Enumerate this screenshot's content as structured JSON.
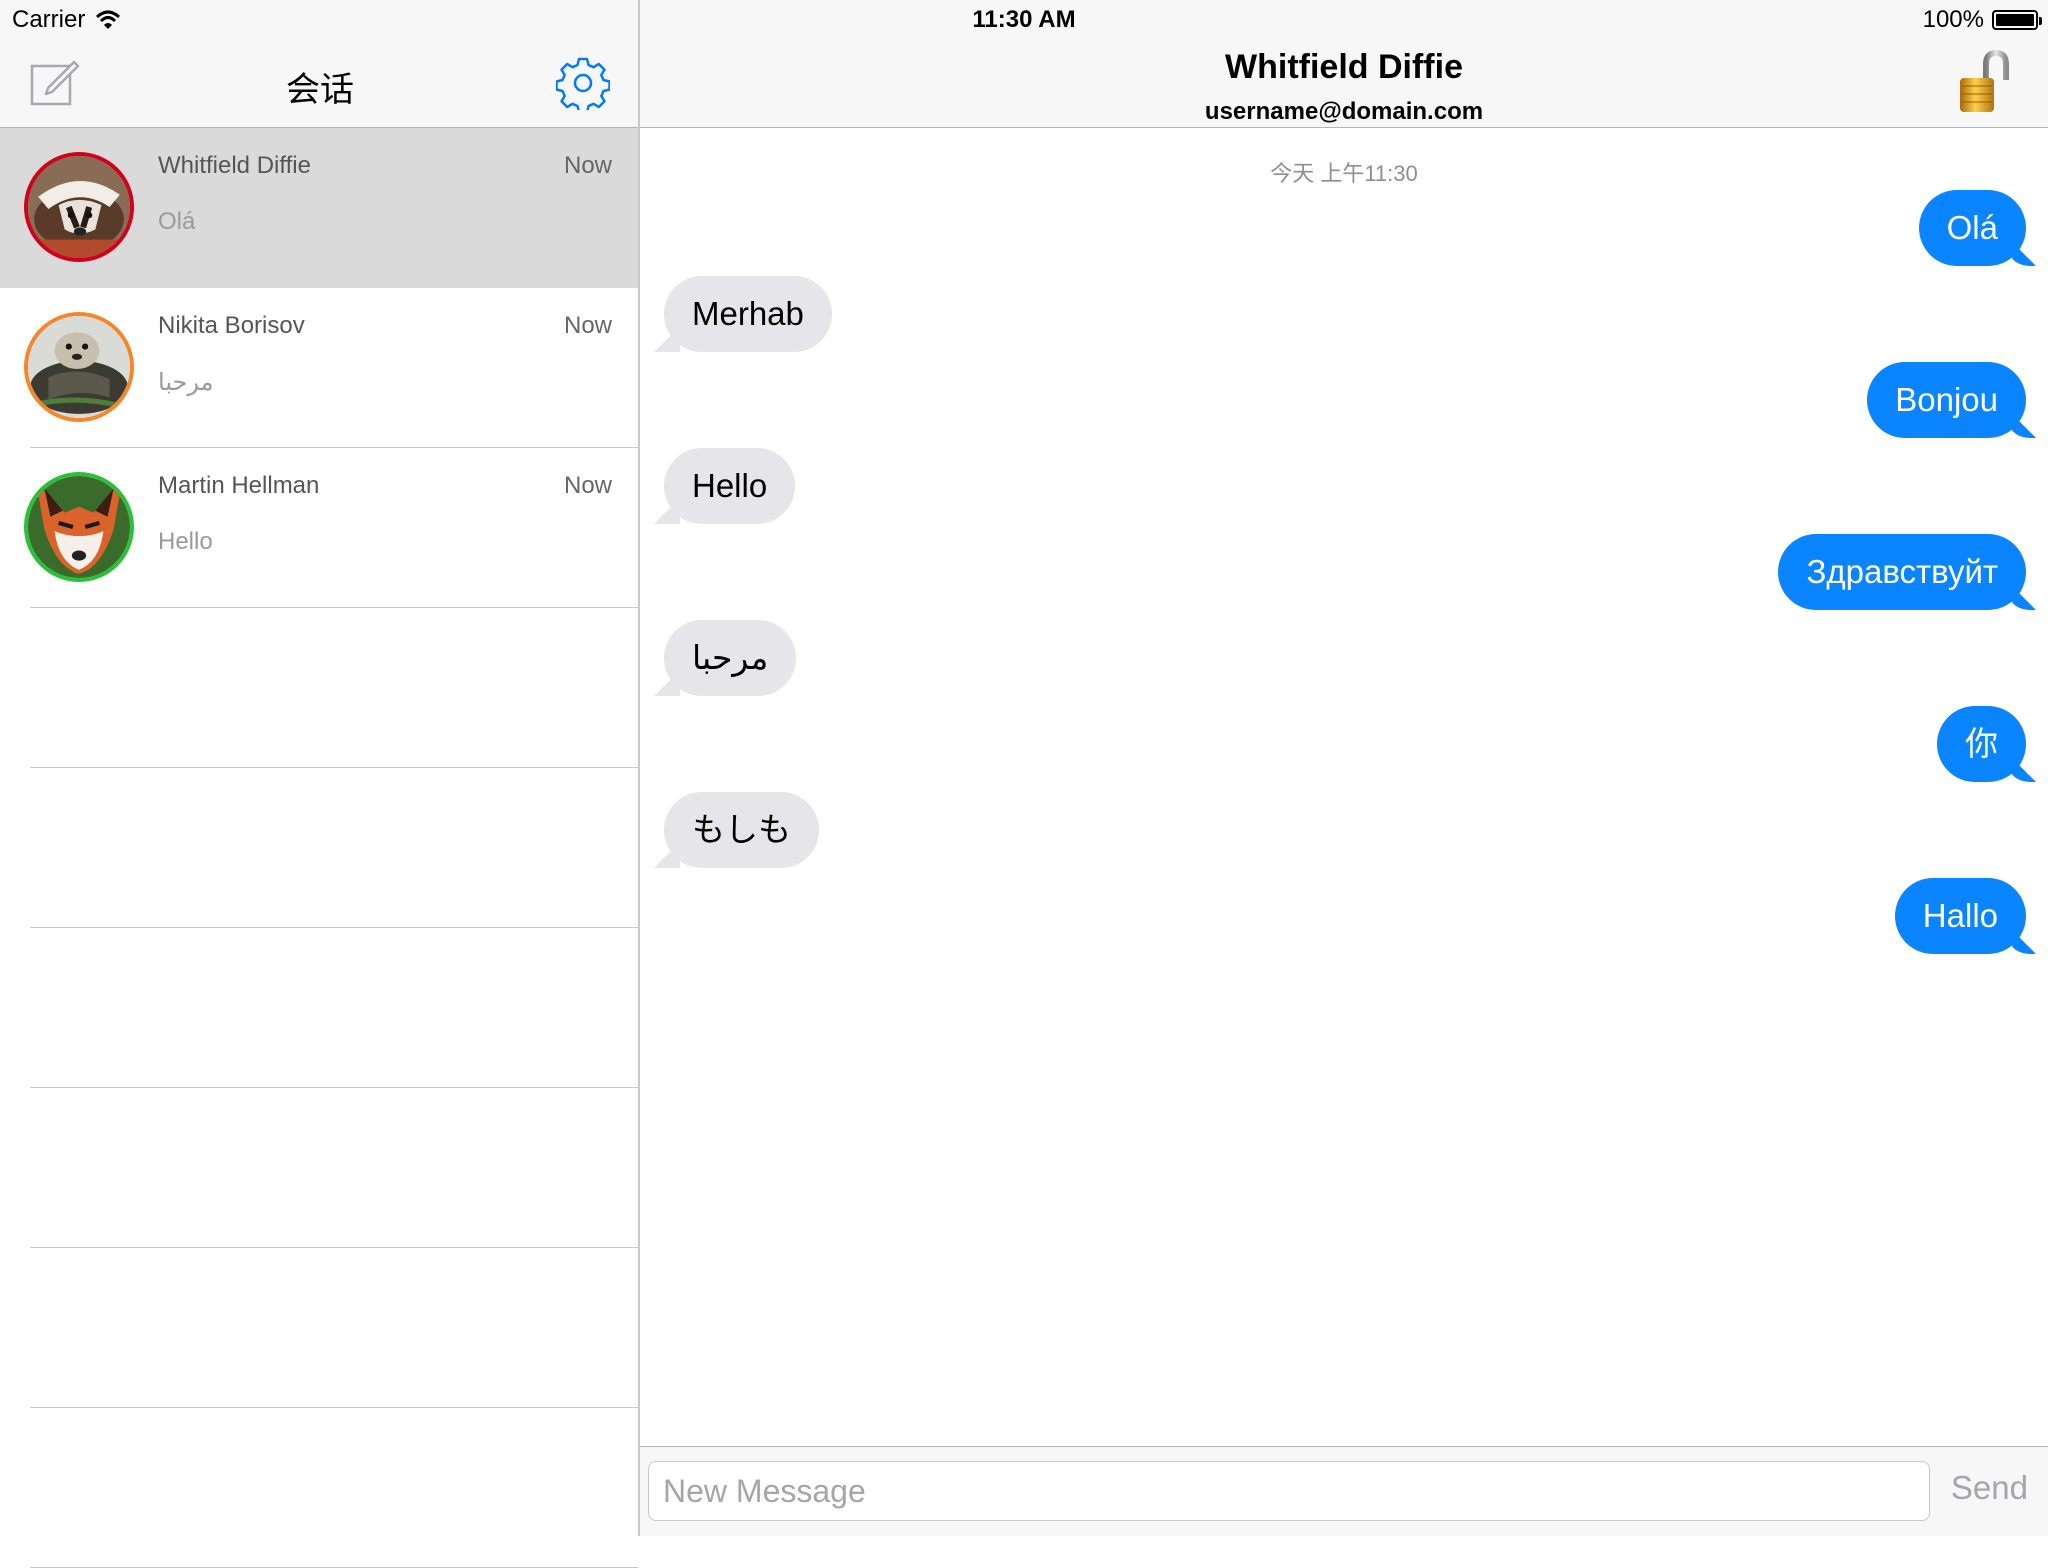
{
  "status_bar": {
    "carrier": "Carrier",
    "time": "11:30 AM",
    "battery": "100%",
    "battery_level": 1.0
  },
  "sidebar": {
    "title": "会话",
    "compose_icon": "compose-icon",
    "settings_icon": "gear-icon",
    "accent": "#007aff",
    "conversations": [
      {
        "name": "Whitfield Diffie",
        "time": "Now",
        "preview": "Olá",
        "ring_color": "#d0021b",
        "avatar": "badger",
        "selected": true
      },
      {
        "name": "Nikita Borisov",
        "time": "Now",
        "preview": "مرحبا",
        "ring_color": "#f5872a",
        "avatar": "otter",
        "selected": false
      },
      {
        "name": "Martin Hellman",
        "time": "Now",
        "preview": "Hello",
        "ring_color": "#2bc03a",
        "avatar": "fox",
        "selected": false
      }
    ]
  },
  "chat": {
    "contact_name": "Whitfield Diffie",
    "contact_email": "username@domain.com",
    "lock_icon": "unlocked-padlock-icon",
    "timestamp": "今天 上午11:30",
    "outgoing_color": "#0a84ff",
    "incoming_color": "#e5e5ea",
    "messages": [
      {
        "direction": "out",
        "text": "Olá"
      },
      {
        "direction": "in",
        "text": "Merhab"
      },
      {
        "direction": "out",
        "text": "Bonjou"
      },
      {
        "direction": "in",
        "text": "Hello"
      },
      {
        "direction": "out",
        "text": "Здравствуйт"
      },
      {
        "direction": "in",
        "text": "مرحبا"
      },
      {
        "direction": "out",
        "text": "你"
      },
      {
        "direction": "in",
        "text": "もしも"
      },
      {
        "direction": "out",
        "text": "Hallo"
      }
    ],
    "input_placeholder": "New Message",
    "input_value": "",
    "send_label": "Send"
  }
}
